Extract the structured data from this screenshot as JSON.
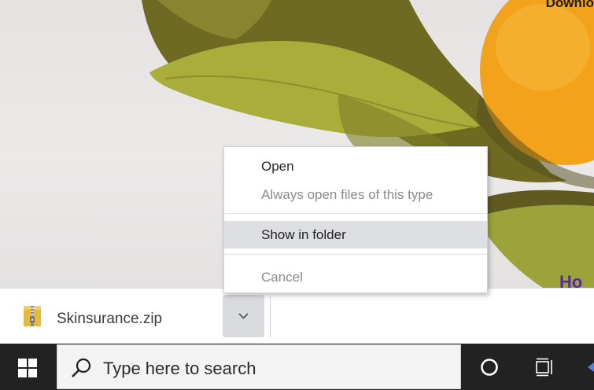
{
  "webpage": {
    "heading_partial": "Downlo",
    "link_partial": "Ho"
  },
  "download_shelf": {
    "file_name": "Skinsurance.zip",
    "file_icon": "zip-archive-icon",
    "options_icon": "chevron-down-icon"
  },
  "context_menu": {
    "items": [
      {
        "label": "Open",
        "enabled": true,
        "highlighted": false
      },
      {
        "label": "Always open files of this type",
        "enabled": false,
        "highlighted": false
      },
      {
        "label": "Show in folder",
        "enabled": true,
        "highlighted": true
      },
      {
        "label": "Cancel",
        "enabled": false,
        "highlighted": false
      }
    ]
  },
  "taskbar": {
    "start_icon": "windows-logo-icon",
    "search": {
      "icon": "search-icon",
      "placeholder": "Type here to search"
    },
    "cortana_icon": "cortana-circle-icon",
    "task_view_icon": "task-view-icon"
  },
  "colors": {
    "menu_highlight": "#dedfe3",
    "chevron_button_bg": "#dadbdf",
    "taskbar_bg": "#222222",
    "search_box_bg": "#f3f3f3",
    "link_color": "#5b2aa0"
  }
}
